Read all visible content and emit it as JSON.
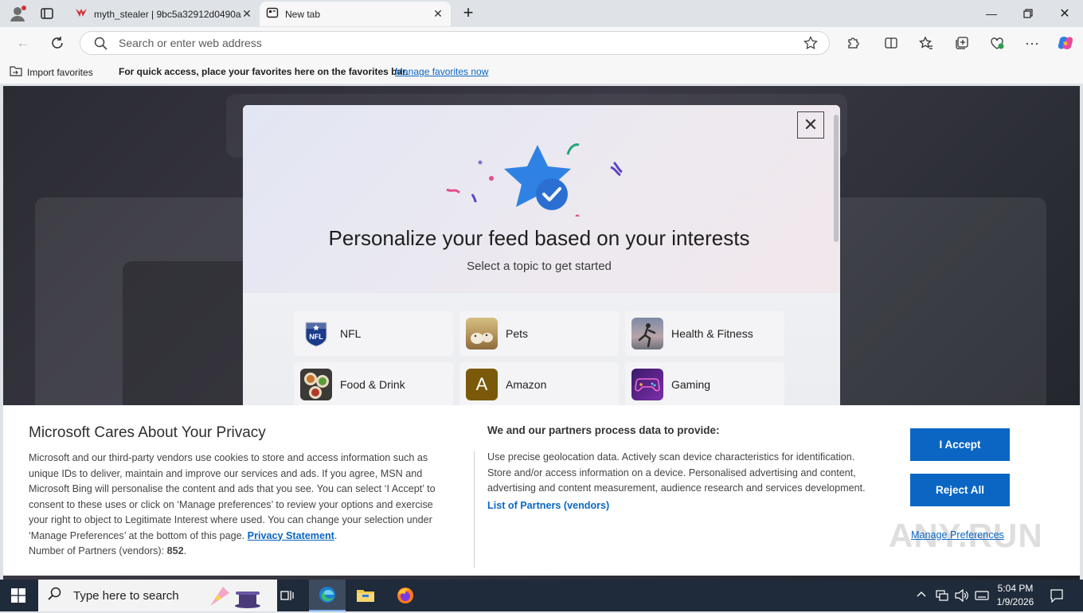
{
  "browser": {
    "tabs": [
      {
        "title": "myth_stealer | 9bc5a32912d0490a",
        "active": false
      },
      {
        "title": "New tab",
        "active": true
      }
    ],
    "address": {
      "placeholder": "Search or enter web address"
    }
  },
  "favorites_bar": {
    "import_label": "Import favorites",
    "message": "For quick access, place your favorites here on the favorites bar.",
    "manage_link": "Manage favorites now"
  },
  "modal": {
    "title": "Personalize your feed based on your interests",
    "subtitle": "Select a topic to get started",
    "close_symbol": "✕",
    "topics": [
      {
        "label": "NFL",
        "icon": "nfl-logo-icon"
      },
      {
        "label": "Pets",
        "icon": "pets-photo-icon"
      },
      {
        "label": "Health & Fitness",
        "icon": "fitness-photo-icon"
      },
      {
        "label": "Food & Drink",
        "icon": "food-photo-icon"
      },
      {
        "label": "Amazon",
        "icon": "amazon-letter-icon",
        "letter": "A"
      },
      {
        "label": "Gaming",
        "icon": "gamepad-icon"
      }
    ]
  },
  "privacy": {
    "title": "Microsoft Cares About Your Privacy",
    "body": "Microsoft and our third-party vendors use cookies to store and access information such as unique IDs to deliver, maintain and improve our services and ads. If you agree, MSN and Microsoft Bing will personalise the content and ads that you see. You can select ‘I Accept’ to consent to these uses or click on ‘Manage preferences’ to review your options and exercise your right to object to Legitimate Interest where used.  You can change your selection under ‘Manage Preferences’ at the bottom of this page.",
    "privacy_link": "Privacy Statement",
    "partners_prefix": "Number of Partners (vendors):",
    "partners_count": "852",
    "heading2": "We and our partners process data to provide:",
    "body2": "Use precise geolocation data. Actively scan device characteristics for identification. Store and/or access information on a device. Personalised advertising and content, advertising and content measurement, audience research and services development.",
    "partners_link": "List of Partners (vendors)",
    "accept_label": "I Accept",
    "reject_label": "Reject All",
    "manage_label": "Manage Preferences",
    "watermark": "ANY.RUN"
  },
  "taskbar": {
    "search_placeholder": "Type here to search",
    "time": "5:04 PM",
    "date": "1/9/2026"
  },
  "colors": {
    "accent": "#0b66c3",
    "taskbar": "#1f2b3a"
  }
}
